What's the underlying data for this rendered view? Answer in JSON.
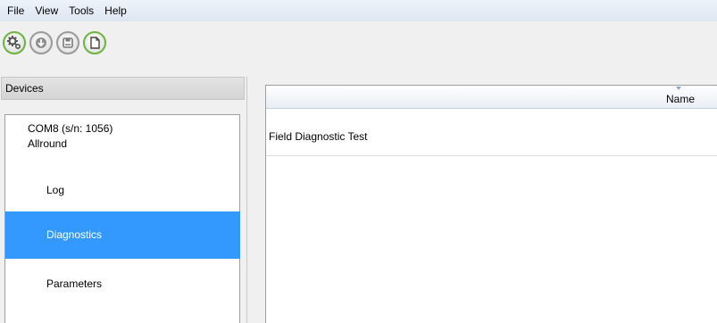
{
  "menu": [
    "File",
    "View",
    "Tools",
    "Help"
  ],
  "toolbar": {
    "buttons": [
      {
        "icon": "connect-gears-icon",
        "enabled": true
      },
      {
        "icon": "download-arrow-icon",
        "enabled": false
      },
      {
        "icon": "save-disk-icon",
        "enabled": false
      },
      {
        "icon": "document-icon",
        "enabled": true
      }
    ],
    "enabled_color": "#6db33f",
    "disabled_color": "#9a9a9a"
  },
  "devices": {
    "header": "Devices",
    "device": {
      "port": "COM8 (s/n: 1056)",
      "model": "Allround"
    },
    "nodes": [
      {
        "label": "Log",
        "selected": false
      },
      {
        "label": "Diagnostics",
        "selected": true
      },
      {
        "label": "Parameters",
        "selected": false
      }
    ],
    "selection_color": "#3399ff"
  },
  "table": {
    "columns": [
      "Name"
    ],
    "rows": [
      {
        "name": "Field Diagnostic Test"
      }
    ]
  }
}
